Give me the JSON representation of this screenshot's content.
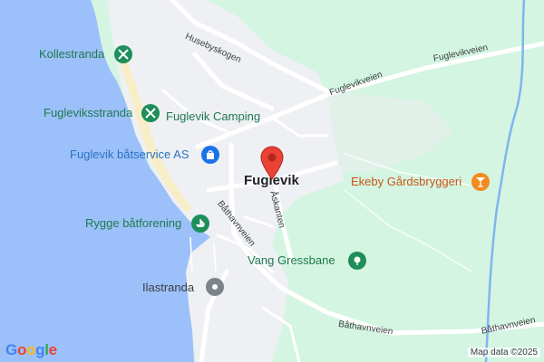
{
  "map": {
    "places": {
      "town": "Fuglevik"
    },
    "roads": {
      "husebyskogen": "Husebyskogen",
      "fuglevikveien_a": "Fuglevikveien",
      "fuglevikveien_b": "Fuglevikveien",
      "askanten": "Åskanten",
      "bathavnveien_a": "Båthavnveien",
      "bathavnveien_b": "Båthavnveien",
      "bathavnveien_c": "Båthavnveien"
    },
    "pois": [
      {
        "name": "Kollestranda",
        "icon": "beach-icon",
        "color": "#1e8e5a"
      },
      {
        "name": "Fugleviksstranda",
        "icon": "beach-icon",
        "color": "#1e8e5a"
      },
      {
        "name": "Fuglevik Camping",
        "icon": "",
        "color": "#1e8e5a"
      },
      {
        "name": "Fuglevik båtservice AS",
        "icon": "shopping-bag-icon",
        "color": "#1a73e8"
      },
      {
        "name": "Ekeby Gårdsbryggeri",
        "icon": "cocktail-icon",
        "color": "#f28b20"
      },
      {
        "name": "Rygge båtforening",
        "icon": "boat-icon",
        "color": "#1e8e5a"
      },
      {
        "name": "Vang Gressbane",
        "icon": "park-icon",
        "color": "#1e8e5a"
      },
      {
        "name": "Ilastranda",
        "icon": "place-icon",
        "color": "#7b8489"
      }
    ],
    "marker": {
      "icon": "location-pin-icon",
      "color": "#ea4335"
    },
    "logo": "Google",
    "attribution": "Map data ©2025"
  }
}
